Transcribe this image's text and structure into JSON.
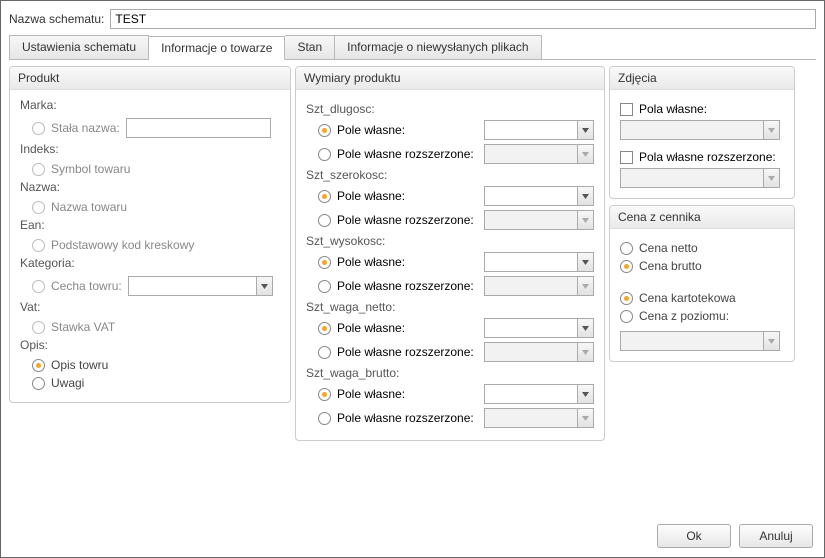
{
  "header": {
    "label": "Nazwa schematu:",
    "value": "TEST"
  },
  "tabs": [
    {
      "label": "Ustawienia schematu"
    },
    {
      "label": "Informacje o towarze",
      "active": true
    },
    {
      "label": "Stan"
    },
    {
      "label": "Informacje o niewysłanych plikach"
    }
  ],
  "produkt": {
    "title": "Produkt",
    "marka": {
      "label": "Marka:",
      "fixed_name_label": "Stała nazwa:"
    },
    "indeks": {
      "label": "Indeks:",
      "option": "Symbol towaru"
    },
    "nazwa": {
      "label": "Nazwa:",
      "option": "Nazwa towaru"
    },
    "ean": {
      "label": "Ean:",
      "option": "Podstawowy kod kreskowy"
    },
    "kategoria": {
      "label": "Kategoria:",
      "option": "Cecha towru:"
    },
    "vat": {
      "label": "Vat:",
      "option": "Stawka VAT"
    },
    "opis": {
      "label": "Opis:",
      "options": [
        "Opis towru",
        "Uwagi"
      ]
    }
  },
  "wymiary": {
    "title": "Wymiary produktu",
    "dims": [
      {
        "label": "Szt_dlugosc:"
      },
      {
        "label": "Szt_szerokosc:"
      },
      {
        "label": "Szt_wysokosc:"
      },
      {
        "label": "Szt_waga_netto:"
      },
      {
        "label": "Szt_waga_brutto:"
      }
    ],
    "pole_wlasne": "Pole własne:",
    "pole_rozszerzone": "Pole własne rozszerzone:"
  },
  "zdjecia": {
    "title": "Zdjęcia",
    "pola_wlasne": "Pola własne:",
    "pola_rozszerzone": "Pola własne rozszerzone:"
  },
  "cena": {
    "title": "Cena z cennika",
    "netto": "Cena netto",
    "brutto": "Cena brutto",
    "kartotekowa": "Cena kartotekowa",
    "z_poziomu": "Cena z poziomu:"
  },
  "buttons": {
    "ok": "Ok",
    "cancel": "Anuluj"
  }
}
